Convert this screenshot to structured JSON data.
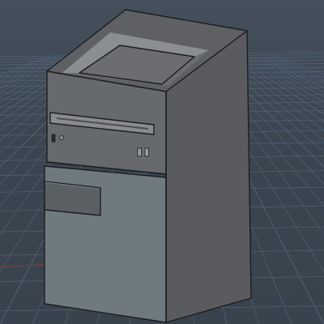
{
  "viewport": {
    "background_color": "#3d4650",
    "grid_color": "#56697d",
    "grid_axis_color": "#a04040"
  },
  "model": {
    "object": "computer-tower",
    "colors": {
      "top_face": "#5e6063",
      "top_recess": "#6b6d70",
      "top_recess_wall": "#8b8e91",
      "front_upper": "#676a6d",
      "front_lower": "#6f7a80",
      "side_face": "#595b5e",
      "drive_bay": "#8a8c8e",
      "panel": "#5b6064"
    },
    "front_ports": {
      "usb_port_count": 2,
      "power_button": true
    }
  }
}
